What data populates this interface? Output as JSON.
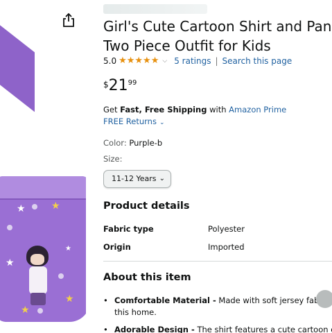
{
  "product": {
    "title": "Girl's Cute Cartoon Shirt and Pants Two Piece Outfit for Kids",
    "rating_value": "5.0",
    "stars_glyphs": "★★★★★",
    "ratings_count": "5 ratings",
    "rating_separator": "|",
    "search_link": "Search this page",
    "price": {
      "symbol": "$",
      "whole": "21",
      "fraction": "99"
    },
    "shipping": {
      "prefix": "Get",
      "fast_free": "Fast, Free Shipping",
      "with": "with",
      "program": "Amazon Prime"
    },
    "returns": "FREE Returns",
    "color_label": "Color:",
    "color_value": "Purple-b",
    "size_label": "Size:",
    "size_selected": "11-12 Years"
  },
  "product_details": {
    "heading": "Product details",
    "rows": [
      {
        "key": "Fabric type",
        "value": "Polyester"
      },
      {
        "key": "Origin",
        "value": "Imported"
      }
    ]
  },
  "about": {
    "heading": "About this item",
    "bullets": [
      {
        "lead": "Comfortable Material -",
        "text": "Made with soft jersey fabric, this home."
      },
      {
        "lead": "Adorable Design -",
        "text": "The shirt features a cute cartoon grap"
      }
    ]
  },
  "icons": {
    "share": "share-icon",
    "chevron": "chevron-down-icon",
    "star": "star-icon"
  },
  "colors": {
    "link": "#2162a1",
    "star": "#e7900e",
    "text": "#0f1111",
    "muted": "#565959",
    "product_purple": "#9a6fd4"
  }
}
